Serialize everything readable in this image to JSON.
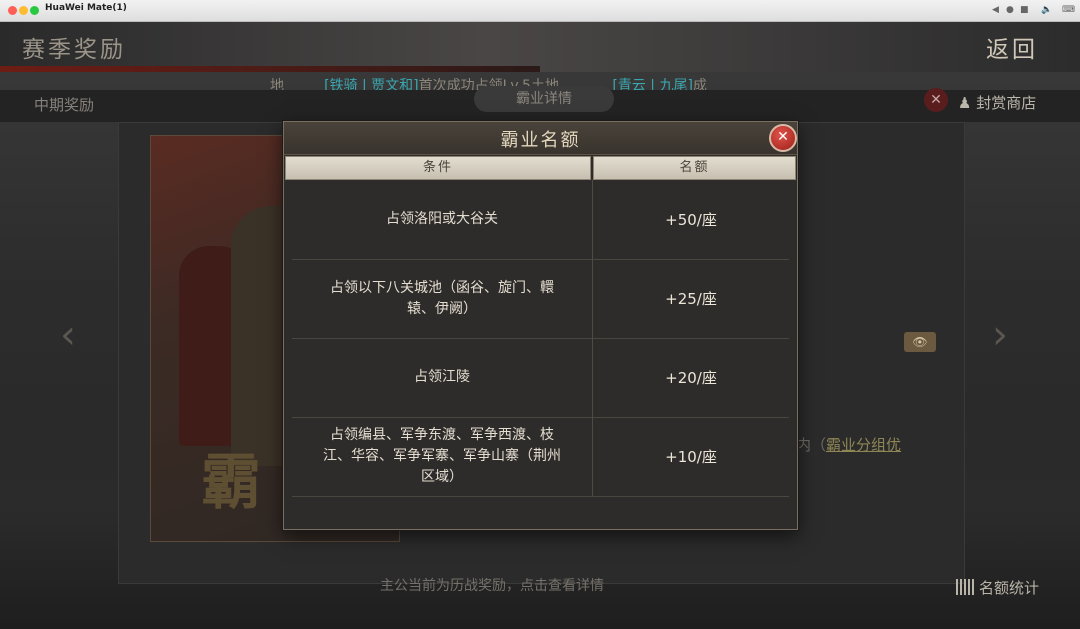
{
  "window": {
    "title": "HuaWei Mate(1)",
    "fps": "30"
  },
  "header": {
    "title": "赛季奖励",
    "back": "返回",
    "ticker_prefix": "地",
    "ticker_p1": "[铁骑 | 贾文和]",
    "ticker_mid": "首次成功占领Lv.5土地",
    "ticker_p2": "[青云 | 九尾]",
    "ticker_suffix": "成"
  },
  "subheader": {
    "mid_reward": "中期奖励",
    "tab": "霸业详情",
    "shop": "封赏商店"
  },
  "background": {
    "art_glyph": "霸",
    "group_text_prefix": "内（",
    "group_text_link": "霸业分组优",
    "bottom_tip": "主公当前为历战奖励，点击查看详情",
    "stats_button": "名额统计"
  },
  "modal": {
    "title": "霸业名额",
    "close_symbol": "✕",
    "columns": [
      "条件",
      "名额"
    ],
    "rows": [
      {
        "condition": "占领洛阳或大谷关",
        "quota": "+50/座"
      },
      {
        "condition": "占领以下八关城池（函谷、旋门、轘辕、伊阙）",
        "quota": "+25/座"
      },
      {
        "condition": "占领江陵",
        "quota": "+20/座"
      },
      {
        "condition": "占领编县、军争东渡、军争西渡、枝江、华容、军争军寨、军争山寨（荆州区域）",
        "quota": "+10/座"
      }
    ]
  },
  "icons": {
    "nav_left": "‹",
    "nav_right": "›",
    "eye": "👁",
    "close_bg": "✕"
  }
}
